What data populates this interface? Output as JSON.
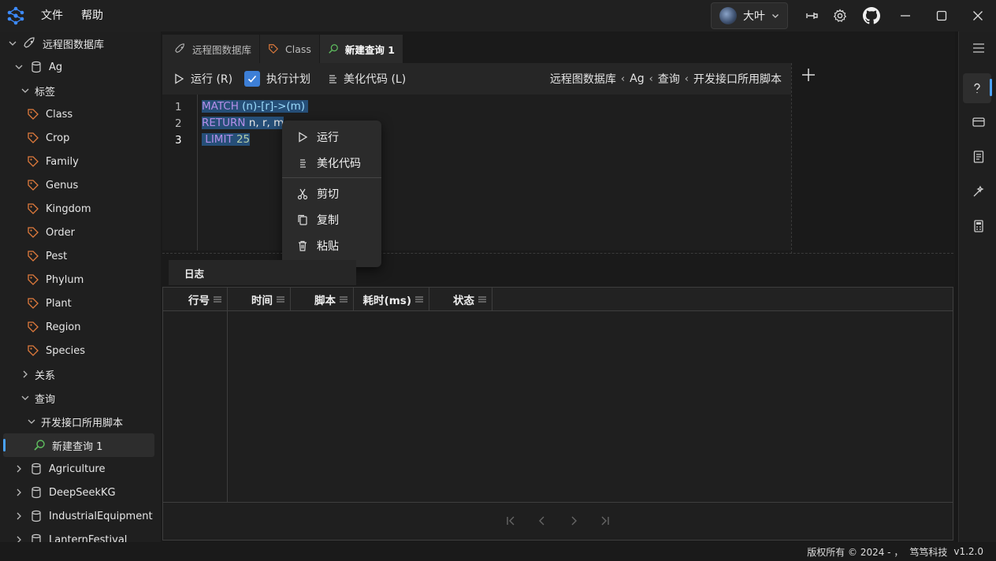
{
  "app": {
    "menus": [
      "文件",
      "帮助"
    ],
    "user": "大叶",
    "version": "v1.2.0",
    "copyright": "版权所有 © 2024 - ，",
    "company": "笃笃科技"
  },
  "sidebar": {
    "root": "远程图数据库",
    "db": "Ag",
    "labels_group": "标签",
    "labels": [
      "Class",
      "Crop",
      "Family",
      "Genus",
      "Kingdom",
      "Order",
      "Pest",
      "Phylum",
      "Plant",
      "Region",
      "Species"
    ],
    "relations_group": "关系",
    "queries_group": "查询",
    "query_folder": "开发接口所用脚本",
    "selected_query": "新建查询 1",
    "other_dbs": [
      "Agriculture",
      "DeepSeekKG",
      "IndustrialEquipment",
      "LanternFestival"
    ]
  },
  "tabs": [
    {
      "label": "远程图数据库",
      "icon": "rocket-icon"
    },
    {
      "label": "Class",
      "icon": "tag-icon"
    },
    {
      "label": "新建查询 1",
      "icon": "search-icon"
    }
  ],
  "toolbar": {
    "run": "运行 (R)",
    "plan": "执行计划",
    "plan_checked": true,
    "beautify": "美化代码 (L)"
  },
  "breadcrumb": [
    "远程图数据库",
    "Ag",
    "查询",
    "开发接口所用脚本"
  ],
  "editor": {
    "line_numbers": [
      "1",
      "2",
      "3"
    ],
    "lines": [
      {
        "kw": "MATCH",
        "rest1": " (n)-[r]->(m) "
      },
      {
        "kw": "RETURN",
        "rest1": " n, r, m"
      },
      {
        "kw": " LIMIT",
        "num": " 25"
      }
    ]
  },
  "context_menu": [
    "运行",
    "美化代码",
    "剪切",
    "复制",
    "粘贴"
  ],
  "log": {
    "tab": "日志",
    "columns": [
      "行号",
      "时间",
      "脚本",
      "耗时(ms)",
      "状态"
    ]
  },
  "colors": {
    "accent": "#4aa3ff",
    "checkbox": "#3d7fd6",
    "keyword": "#b48ee8",
    "tag_icon": "#e07b3c"
  }
}
